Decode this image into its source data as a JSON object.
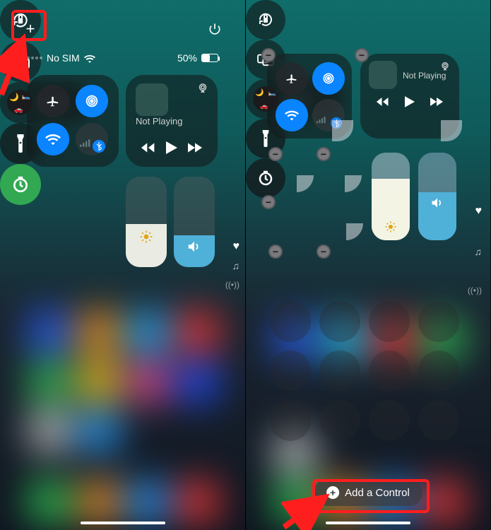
{
  "status": {
    "carrier": "No SIM",
    "battery_text": "50%",
    "battery_fill_pct": 50
  },
  "media": {
    "label": "Not Playing"
  },
  "focus": {
    "label": "Focus"
  },
  "sliders": {
    "brightness_pct_left": 48,
    "volume_pct_left": 35,
    "brightness_pct_right": 70,
    "volume_pct_right": 55
  },
  "add_control": {
    "label": "Add a Control"
  },
  "icons": {
    "add": "+",
    "minus": "−",
    "plus_small": "+"
  }
}
